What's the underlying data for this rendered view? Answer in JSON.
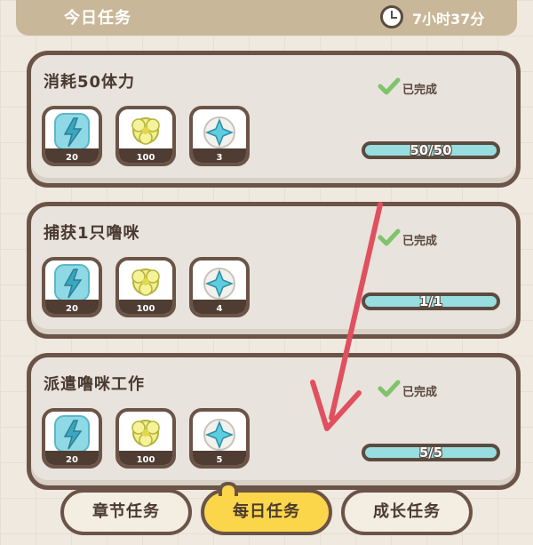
{
  "header": {
    "title": "今日任务",
    "timer": "7小时37分"
  },
  "tasks": [
    {
      "title": "消耗50体力",
      "rewards": [
        {
          "icon": "lightning-icon",
          "qty": "20"
        },
        {
          "icon": "flower-icon",
          "qty": "100"
        },
        {
          "icon": "star-gem-icon",
          "qty": "3"
        }
      ],
      "status": "已完成",
      "progress_text": "50/50",
      "progress": 1.0
    },
    {
      "title": "捕获1只噜咪",
      "rewards": [
        {
          "icon": "lightning-icon",
          "qty": "20"
        },
        {
          "icon": "flower-icon",
          "qty": "100"
        },
        {
          "icon": "star-gem-icon",
          "qty": "4"
        }
      ],
      "status": "已完成",
      "progress_text": "1/1",
      "progress": 1.0
    },
    {
      "title": "派遣噜咪工作",
      "rewards": [
        {
          "icon": "lightning-icon",
          "qty": "20"
        },
        {
          "icon": "flower-icon",
          "qty": "100"
        },
        {
          "icon": "star-gem-icon",
          "qty": "5"
        }
      ],
      "status": "已完成",
      "progress_text": "5/5",
      "progress": 1.0
    }
  ],
  "tabs": [
    {
      "label": "章节任务",
      "active": false
    },
    {
      "label": "每日任务",
      "active": true
    },
    {
      "label": "成长任务",
      "active": false
    }
  ],
  "colors": {
    "accent_tab": "#fbd64a",
    "border": "#6b5447",
    "progress": "#98dde0",
    "check": "#7fc36a",
    "arrow": "#e0505e"
  }
}
